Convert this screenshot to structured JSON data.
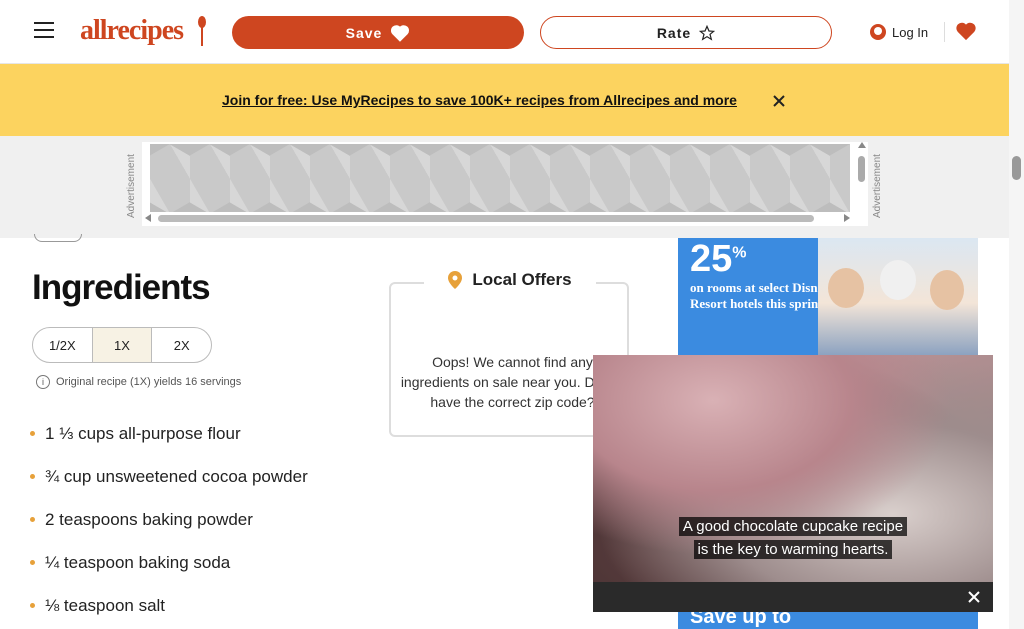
{
  "header": {
    "logo_text": "allrecipes",
    "save_label": "Save",
    "rate_label": "Rate",
    "login_label": "Log In"
  },
  "promo": {
    "link_text": "Join for free: Use MyRecipes to save 100K+ recipes from Allrecipes and more"
  },
  "ads": {
    "label": "Advertisement",
    "right_ad": {
      "percent": "25",
      "percent_sign": "%",
      "text": "on rooms at select Disney Resort hotels this spring.",
      "bottom_text": "Save up to"
    }
  },
  "ingredients": {
    "title": "Ingredients",
    "scale_options": [
      "1/2X",
      "1X",
      "2X"
    ],
    "scale_selected": "1X",
    "yield_text": "Original recipe (1X) yields 16 servings",
    "items": [
      "1 ⅓ cups all-purpose flour",
      "¾ cup unsweetened cocoa powder",
      "2 teaspoons baking powder",
      "¼ teaspoon baking soda",
      "⅛ teaspoon salt"
    ]
  },
  "local_offers": {
    "title": "Local Offers",
    "message": "Oops! We cannot find any ingredients on sale near you. Do we have the correct zip code?"
  },
  "video": {
    "caption_line1": "A good chocolate cupcake recipe",
    "caption_line2": "is the key to warming hearts."
  },
  "colors": {
    "brand": "#ce4620",
    "promo_bg": "#fcd35f",
    "ad_bg": "#3b8be0"
  }
}
